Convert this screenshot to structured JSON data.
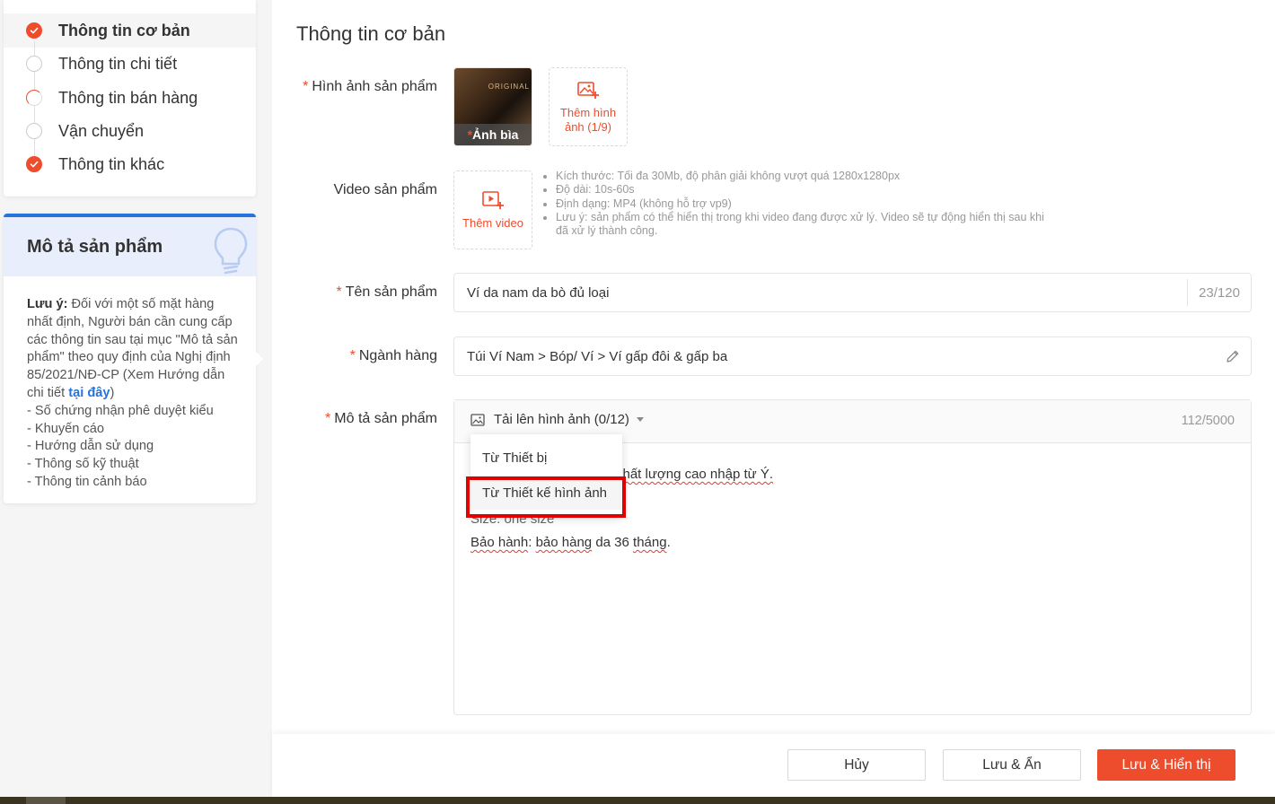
{
  "nav": {
    "items": [
      {
        "label": "Thông tin cơ bản",
        "status": "done",
        "active": true
      },
      {
        "label": "Thông tin chi tiết",
        "status": "empty",
        "active": false
      },
      {
        "label": "Thông tin bán hàng",
        "status": "partial",
        "active": false
      },
      {
        "label": "Vận chuyển",
        "status": "empty",
        "active": false
      },
      {
        "label": "Thông tin khác",
        "status": "done",
        "active": false
      }
    ]
  },
  "tips": {
    "title": "Mô tả sản phẩm",
    "note_label": "Lưu ý:",
    "note_text": " Đối với một số mặt hàng nhất định, Người bán cần cung cấp các thông tin sau tại mục \"Mô tả sản phẩm\" theo quy định của Nghị định 85/2021/NĐ-CP (Xem Hướng dẫn chi tiết ",
    "note_link": "tại đây",
    "note_close": ")",
    "bullets": [
      "- Số chứng nhận phê duyệt kiểu",
      "- Khuyến cáo",
      "- Hướng dẫn sử dụng",
      "- Thông số kỹ thuật",
      "- Thông tin cảnh báo"
    ]
  },
  "form": {
    "section_title": "Thông tin cơ bản",
    "images": {
      "label": "Hình ảnh sản phẩm",
      "cover_caption": "Ảnh bìa",
      "cover_tag": "ORIGINAL",
      "add_label": "Thêm hình ảnh (1/9)"
    },
    "video": {
      "label": "Video sản phẩm",
      "add_label": "Thêm video",
      "hints": [
        "Kích thước: Tối đa 30Mb, độ phân giải không vượt quá 1280x1280px",
        "Độ dài: 10s-60s",
        "Định dạng: MP4 (không hỗ trợ vp9)",
        "Lưu ý: sản phẩm có thể hiển thị trong khi video đang được xử lý. Video sẽ tự động hiển thị sau khi đã xử lý thành công."
      ]
    },
    "name": {
      "label": "Tên sản phẩm",
      "value": "Ví da nam da bò đủ loại",
      "counter": "23/120"
    },
    "category": {
      "label": "Ngành hàng",
      "value": "Túi Ví Nam > Bóp/ Ví > Ví gấp đôi & gấp ba"
    },
    "description": {
      "label": "Mô tả sản phẩm",
      "upload_label": "Tải lên hình ảnh (0/12)",
      "counter": "112/5000",
      "line1_visible": "chất lượng cao nhập từ Ý.",
      "line3_visible": "Size: one size",
      "line4_a": "Bảo hành",
      "line4_b": ": ",
      "line4_c": "bảo hàng",
      "line4_d": " da 36 ",
      "line4_e": "tháng",
      "line4_f": "."
    },
    "upload_menu": [
      "Từ Thiết bị",
      "Từ Thiết kế hình ảnh"
    ]
  },
  "footer": {
    "cancel": "Hủy",
    "save_hide": "Lưu & Ẩn",
    "save_show": "Lưu & Hiển thị"
  },
  "colors": {
    "accent": "#ee4d2d",
    "link": "#2673dd",
    "highlight": "#e00000"
  }
}
